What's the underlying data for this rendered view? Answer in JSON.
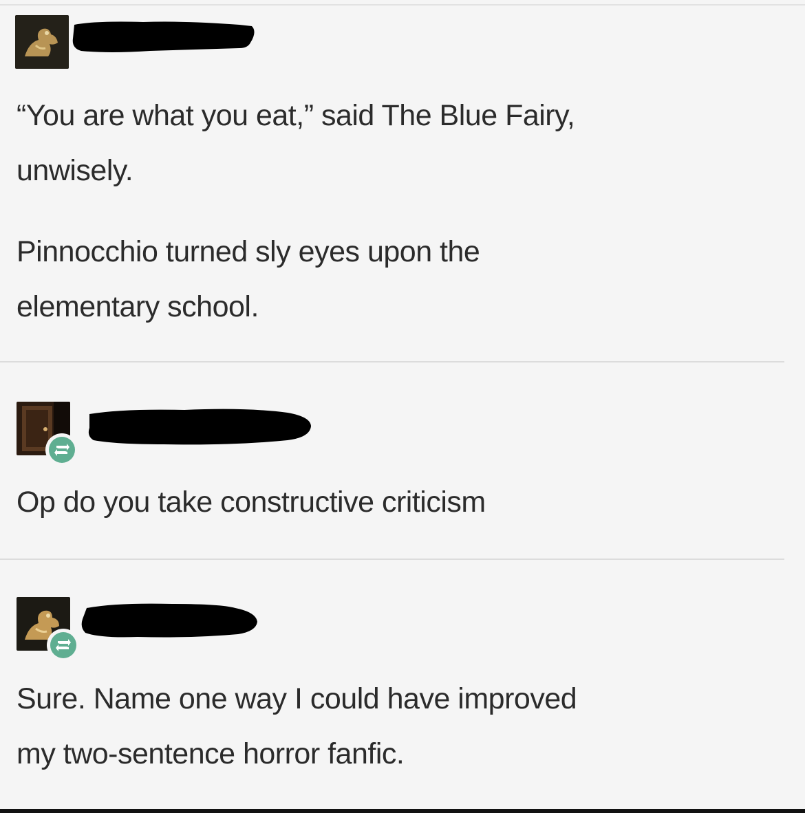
{
  "posts": [
    {
      "avatar_icon": "golden-figure-avatar",
      "username": "",
      "reblog": false,
      "paragraphs": [
        "“You are what you eat,” said The Blue Fairy,",
        "unwisely.",
        "Pinnocchio turned sly eyes upon the",
        "elementary school."
      ]
    },
    {
      "avatar_icon": "dark-door-avatar",
      "username": "",
      "reblog": true,
      "reblog_icon": "reblog-icon",
      "paragraphs": [
        "Op do you take constructive criticism"
      ]
    },
    {
      "avatar_icon": "golden-figure-avatar",
      "username": "",
      "reblog": true,
      "reblog_icon": "reblog-icon",
      "paragraphs": [
        "Sure. Name one way I could have improved",
        "my two-sentence horror fanfic."
      ]
    }
  ],
  "colors": {
    "background": "#f5f5f5",
    "text": "#2b2b2b",
    "reblog_badge": "#5fae91",
    "redaction": "#000000"
  }
}
